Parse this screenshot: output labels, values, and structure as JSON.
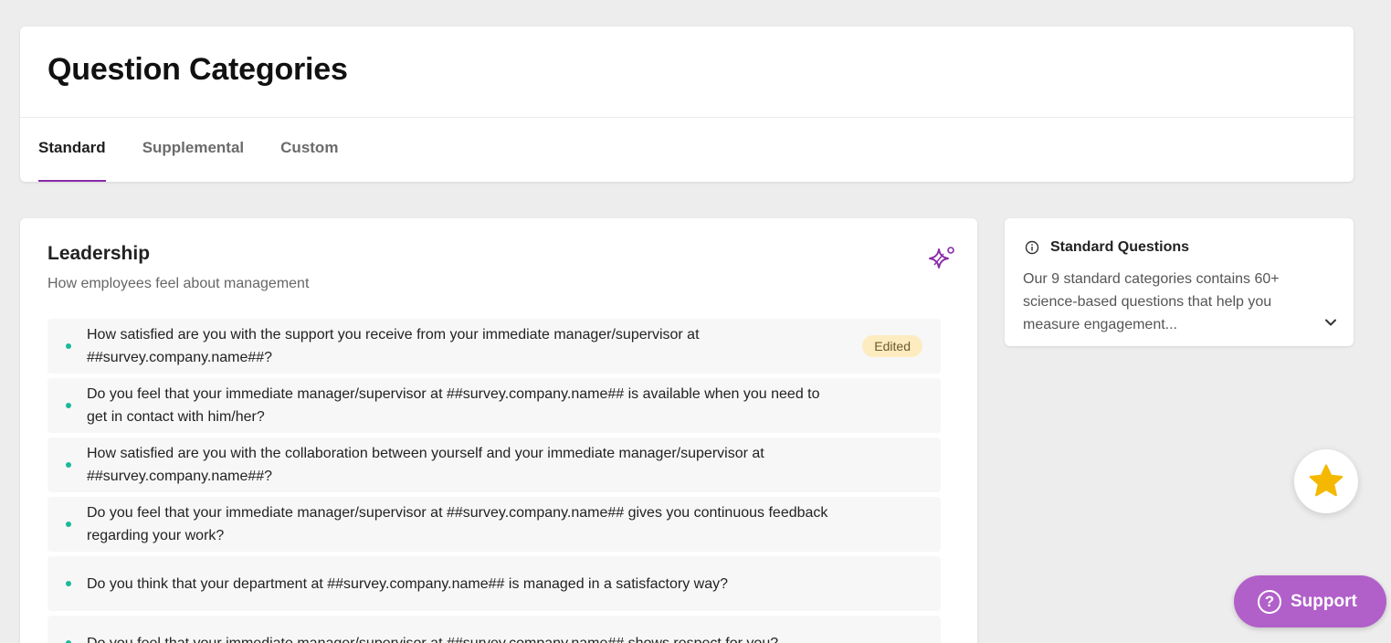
{
  "header": {
    "title": "Question Categories",
    "tabs": [
      {
        "label": "Standard",
        "active": true
      },
      {
        "label": "Supplemental",
        "active": false
      },
      {
        "label": "Custom",
        "active": false
      }
    ]
  },
  "category": {
    "title": "Leadership",
    "subtitle": "How employees feel about management",
    "questions": [
      {
        "text": "How satisfied are you with the support you receive from your immediate manager/supervisor at ##survey.company.name##?",
        "badge": "Edited"
      },
      {
        "text": "Do you feel that your immediate manager/supervisor at ##survey.company.name## is available when you need to get in contact with him/her?"
      },
      {
        "text": "How satisfied are you with the collaboration between yourself and your immediate manager/supervisor at ##survey.company.name##?"
      },
      {
        "text": "Do you feel that your immediate manager/supervisor at ##survey.company.name## gives you continuous feedback regarding your work?"
      },
      {
        "text": "Do you think that your department at ##survey.company.name## is managed in a satisfactory way?"
      },
      {
        "text": "Do you feel that your immediate manager/supervisor at ##survey.company.name## shows respect for you?"
      }
    ]
  },
  "info": {
    "title": "Standard Questions",
    "body": "Our 9 standard categories contains 60+ science-based questions that help you measure engagement..."
  },
  "support": {
    "label": "Support",
    "icon_glyph": "?"
  },
  "colors": {
    "accent": "#8a2aa8",
    "dot": "#1ab99b",
    "badge_bg": "#fdecc0",
    "support_bg": "#b15fc9",
    "star": "#f5b800"
  }
}
